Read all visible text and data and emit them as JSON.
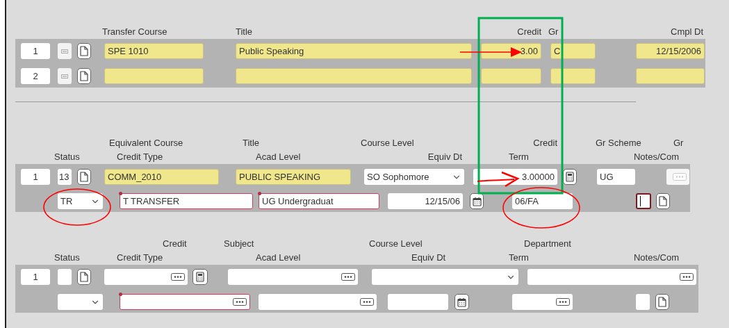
{
  "sections": [
    {
      "header_lines": [
        [
          "Transfer Course",
          "Title",
          "Credit",
          "Gr",
          "Cmpl Dt"
        ]
      ],
      "rows": [
        {
          "fields": [
            {
              "kind": "index",
              "value": "1"
            },
            {
              "kind": "ellipsis-button"
            },
            {
              "kind": "doc-button"
            },
            {
              "kind": "text",
              "value": "SPE 1010",
              "readonly": true,
              "required": false
            },
            {
              "kind": "text",
              "value": "Public Speaking",
              "readonly": true,
              "required": false
            },
            {
              "kind": "text",
              "value": "3.00",
              "readonly": true,
              "required": false
            },
            {
              "kind": "text",
              "value": "C",
              "readonly": true,
              "required": false
            },
            {
              "kind": "text",
              "value": "12/15/2006",
              "readonly": true,
              "required": false
            }
          ]
        },
        {
          "fields": [
            {
              "kind": "index",
              "value": "2"
            },
            {
              "kind": "ellipsis-button"
            },
            {
              "kind": "doc-button"
            },
            {
              "kind": "text",
              "readonly": true,
              "required": false
            },
            {
              "kind": "text",
              "readonly": true,
              "required": false
            },
            {
              "kind": "text",
              "readonly": true,
              "required": false
            },
            {
              "kind": "text",
              "readonly": true,
              "required": false
            },
            {
              "kind": "text",
              "readonly": true,
              "required": false
            }
          ]
        }
      ]
    },
    {
      "header_lines": [
        [
          "Equivalent Course",
          "Title",
          "Course Level",
          "Credit",
          "Gr Scheme",
          "Gr"
        ],
        [
          "Status",
          "Credit Type",
          "Acad Level",
          "Equiv Dt",
          "Term",
          "Notes/Com"
        ]
      ],
      "rows": [
        {
          "fields": [
            {
              "kind": "index",
              "value": "1"
            },
            {
              "kind": "box",
              "value": "13",
              "focused": false
            },
            {
              "kind": "doc-button"
            },
            {
              "kind": "text",
              "value": "COMM_2010",
              "readonly": true,
              "required": false
            },
            {
              "kind": "text",
              "value": "PUBLIC SPEAKING",
              "readonly": true,
              "required": false
            },
            {
              "kind": "select",
              "value": "SO Sophomore"
            },
            {
              "kind": "text",
              "value": "3.00000",
              "readonly": false,
              "required": false
            },
            {
              "kind": "calculator-button"
            },
            {
              "kind": "text",
              "value": "UG",
              "readonly": false,
              "required": false
            },
            {
              "kind": "lookup",
              "required": false,
              "disabled": true
            }
          ]
        },
        {
          "fields": [
            {
              "kind": "select",
              "value": "TR"
            },
            {
              "kind": "text",
              "value": "T TRANSFER",
              "readonly": false,
              "required": true
            },
            {
              "kind": "text",
              "value": "UG Undergraduat",
              "readonly": false,
              "required": true
            },
            {
              "kind": "text",
              "value": "12/15/06",
              "readonly": false,
              "required": false
            },
            {
              "kind": "calendar-button"
            },
            {
              "kind": "text",
              "value": "06/FA",
              "readonly": false,
              "required": false
            },
            {
              "kind": "box",
              "focused": true
            },
            {
              "kind": "doc-button"
            }
          ]
        }
      ]
    },
    {
      "header_lines": [
        [
          "Credit",
          "Subject",
          "Course Level",
          "Department"
        ],
        [
          "Status",
          "Credit Type",
          "Acad Level",
          "Equiv Dt",
          "Term",
          "Notes/Com"
        ]
      ],
      "rows": [
        {
          "fields": [
            {
              "kind": "index",
              "value": "1"
            },
            {
              "kind": "box",
              "focused": false
            },
            {
              "kind": "doc-button"
            },
            {
              "kind": "lookup",
              "required": false,
              "disabled": false
            },
            {
              "kind": "calculator-button"
            },
            {
              "kind": "lookup",
              "required": false,
              "disabled": false
            },
            {
              "kind": "select"
            },
            {
              "kind": "lookup",
              "required": false,
              "disabled": false
            }
          ]
        },
        {
          "fields": [
            {
              "kind": "select"
            },
            {
              "kind": "lookup",
              "required": true,
              "disabled": false
            },
            {
              "kind": "lookup",
              "required": false,
              "disabled": false
            },
            {
              "kind": "text",
              "readonly": false,
              "required": false
            },
            {
              "kind": "calendar-button"
            },
            {
              "kind": "lookup",
              "required": false,
              "disabled": false
            },
            {
              "kind": "box",
              "focused": false
            },
            {
              "kind": "doc-button"
            }
          ]
        }
      ]
    }
  ]
}
